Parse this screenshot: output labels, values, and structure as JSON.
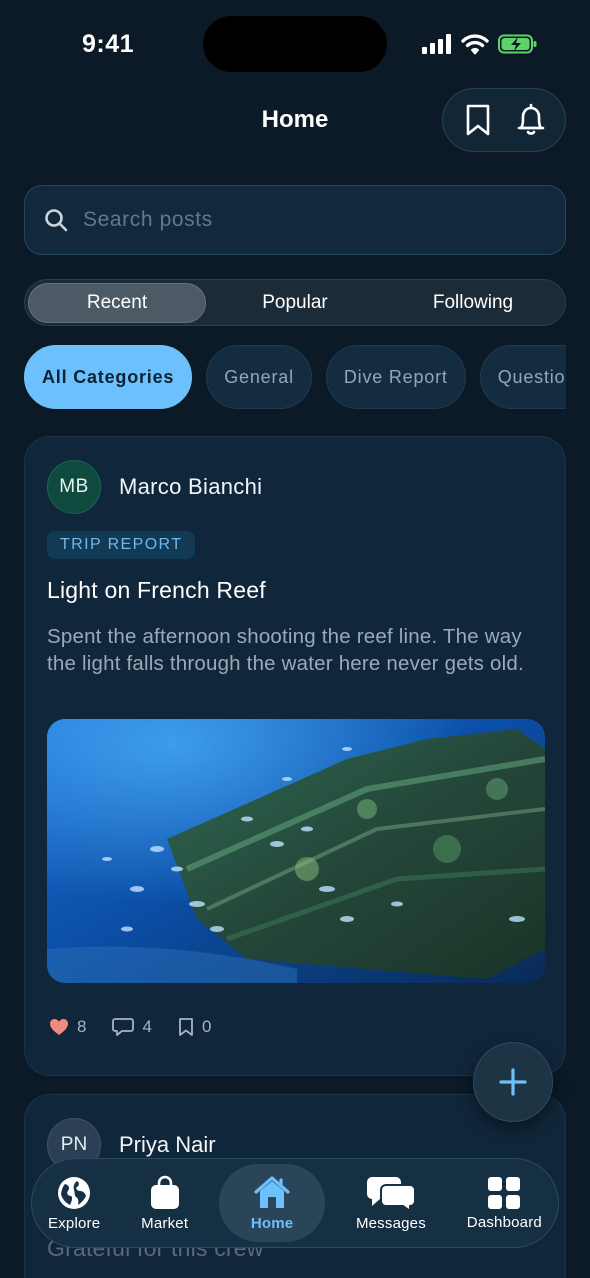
{
  "status": {
    "time": "9:41"
  },
  "header": {
    "title": "Home"
  },
  "search": {
    "placeholder": "Search posts"
  },
  "segments": [
    "Recent",
    "Popular",
    "Following"
  ],
  "chips": [
    "All Categories",
    "General",
    "Dive Report",
    "Question"
  ],
  "post1": {
    "initials": "MB",
    "author": "Marco Bianchi",
    "tag": "TRIP REPORT",
    "title": "Light on French Reef",
    "body": "Spent the afternoon shooting the reef line. The way the light falls through the water here never gets old.",
    "likes": "8",
    "comments": "4",
    "saves": "0"
  },
  "post2": {
    "initials": "PN",
    "author": "Priya Nair",
    "title_peek": "Grateful for this crew"
  },
  "tabs": [
    "Explore",
    "Market",
    "Home",
    "Messages",
    "Dashboard"
  ],
  "colors": {
    "accent": "#6cc0fb",
    "background": "#0b1a26",
    "card": "#10263a",
    "like": "#f08a80"
  },
  "icons": [
    "bookmark-icon",
    "bell-icon",
    "search-icon",
    "heart-icon",
    "comment-icon",
    "plus-icon",
    "globe-icon",
    "bag-icon",
    "home-icon",
    "messages-icon",
    "grid-icon"
  ]
}
